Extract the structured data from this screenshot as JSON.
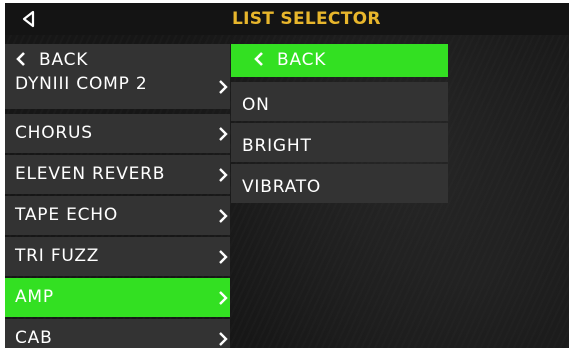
{
  "header": {
    "title": "LIST SELECTOR",
    "back_icon": "triangle-left-icon"
  },
  "colors": {
    "title": "#e8b62c",
    "selection": "#33e022",
    "item_bg": "#333333",
    "text": "#ffffff"
  },
  "left_list": {
    "back_label": "BACK",
    "items": [
      {
        "label": "DYNIII COMP 2"
      },
      {
        "label": "CHORUS"
      },
      {
        "label": "ELEVEN REVERB"
      },
      {
        "label": "TAPE ECHO"
      },
      {
        "label": "TRI FUZZ"
      },
      {
        "label": "AMP",
        "selected": true
      },
      {
        "label": "CAB"
      }
    ]
  },
  "right_list": {
    "back_label": "BACK",
    "items": [
      {
        "label": "ON"
      },
      {
        "label": "BRIGHT"
      },
      {
        "label": "VIBRATO"
      }
    ]
  }
}
